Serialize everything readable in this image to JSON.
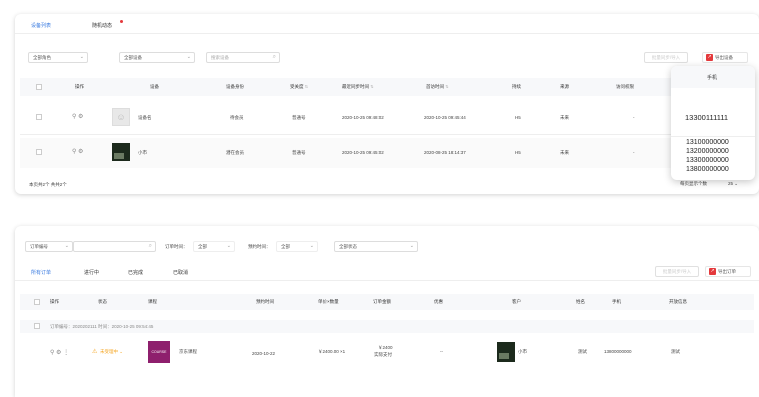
{
  "top": {
    "tabs": [
      "设备列表",
      "随机动态"
    ],
    "filters": {
      "select1": "全部角色",
      "select2": "全部设备",
      "search_placeholder": "搜索设备"
    },
    "btn_batch": "批量同步/导入",
    "btn_export": "导出设备",
    "columns": [
      "操作",
      "设备",
      "设备身份",
      "受关度",
      "最近同步时间",
      "首访时间",
      "持续",
      "来源",
      "访问权限"
    ],
    "rows": [
      {
        "device": "设备名",
        "role": "待会员",
        "level": "普通号",
        "sync": "2020-10-25 09:48:02",
        "first": "2020-10-25 09:45:44",
        "dur": "H5",
        "src": "未来",
        "perm": "-"
      },
      {
        "device": "小市",
        "role": "潜在会员",
        "level": "普通号",
        "sync": "2020-10-25 09:45:02",
        "first": "2020-08-25 18:14:37",
        "dur": "H5",
        "src": "未来",
        "perm": "-"
      }
    ],
    "footer_left": "本页共2个  共共2个",
    "footer_right": "每页显示个数",
    "page_size": "25",
    "popup": {
      "header": "手机",
      "phone_main": "13300111111",
      "phone_list": [
        "13100000000",
        "13200000000",
        "13300000000",
        "13800000000"
      ]
    }
  },
  "bottom": {
    "filters": {
      "select1": "订单编号",
      "label_order_time": "订单时间：",
      "order_time_val": "全部",
      "label_pay_time": "预约时间：",
      "pay_time_val": "全部",
      "select_all": "全部状态"
    },
    "tabs": [
      "所有订单",
      "进行中",
      "已完成",
      "已取消"
    ],
    "btn_batch": "批量同步/导入",
    "btn_export": "导出订单",
    "columns": [
      "操作",
      "状态",
      "课程",
      "预约时间",
      "单价×数量",
      "订单金额",
      "优惠",
      "客户",
      "姓名",
      "手机",
      "开放信息"
    ],
    "group_row": "订单编号：2020202111  时间：2020-10-25 09:54:45",
    "row": {
      "status": "未受理中",
      "course_thumb": "COURSE",
      "course": "京东课程",
      "time": "2020-10-22",
      "price": "￥2400.00 ×1",
      "amount": "￥2400",
      "amount_sub": "实际支付",
      "discount": "--",
      "customer": "小市",
      "name": "测试",
      "phone": "13800000000",
      "open": "测试"
    }
  },
  "colors": {
    "accent": "#3a7be0",
    "export_red": "#e4393c",
    "header_bg": "#f7f8fa",
    "course_purple": "#8e1f6d"
  }
}
